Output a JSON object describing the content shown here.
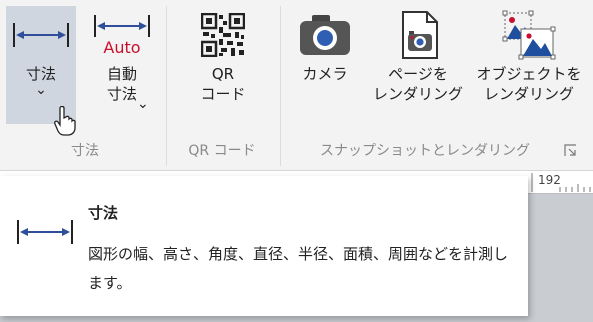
{
  "ribbon": {
    "measure_group": {
      "label": "寸法",
      "dimension_button": {
        "label": "寸法",
        "chevron": "⌄",
        "icon": "dimension-icon"
      },
      "auto_dimension_button": {
        "label": "自動\n寸法",
        "chevron": "⌄",
        "icon_text": "Auto",
        "icon": "auto-dimension-icon"
      }
    },
    "qr_group": {
      "label": "QR コード",
      "qr_button": {
        "label": "QR\nコード",
        "icon": "qr-code-icon"
      }
    },
    "snapshot_group": {
      "label": "スナップショットとレンダリング",
      "camera_button": {
        "label": "カメラ",
        "icon": "camera-icon"
      },
      "render_page_button": {
        "label": "ページを\nレンダリング",
        "icon": "render-page-icon"
      },
      "render_object_button": {
        "label": "オブジェクトを\nレンダリング",
        "icon": "render-object-icon"
      }
    },
    "dialog_launcher_icon": "dialog-launcher-icon"
  },
  "ruler": {
    "number": "192"
  },
  "tooltip": {
    "icon": "dimension-icon",
    "title": "寸法",
    "body": "図形の幅、高さ、角度、直径、半径、面積、周囲などを計測します。"
  },
  "colors": {
    "accent_blue": "#2f4f9a",
    "auto_red": "#c8102e",
    "selected_bg": "#cfd6e0",
    "ribbon_bg": "#f3f3f3"
  }
}
